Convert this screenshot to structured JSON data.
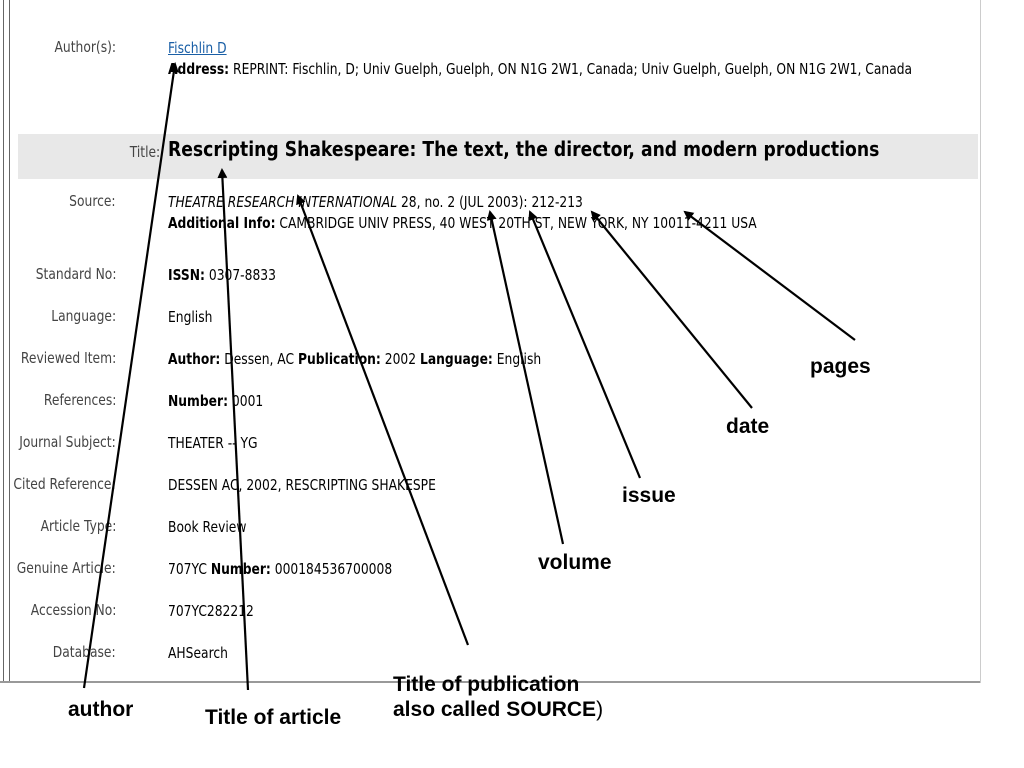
{
  "record": {
    "authors": {
      "label": "Author(s):",
      "name": "Fischlin D",
      "address_label": "Address:",
      "address_text": "REPRINT: Fischlin, D; Univ Guelph, Guelph, ON N1G 2W1, Canada; Univ Guelph, Guelph, ON N1G 2W1, Canada"
    },
    "title": {
      "label": "Title:",
      "value": "Rescripting Shakespeare: The text, the director, and modern productions"
    },
    "source": {
      "label": "Source:",
      "publication": "THEATRE RESEARCH INTERNATIONAL",
      "citation": " 28, no. 2 (JUL 2003): 212-213",
      "info_label": "Additional Info:",
      "info_text": "CAMBRIDGE UNIV PRESS, 40 WEST 20TH ST, NEW YORK, NY 10011-4211 USA"
    },
    "standard_no": {
      "label": "Standard No:",
      "issn_label": "ISSN:",
      "issn": "0307-8833"
    },
    "language": {
      "label": "Language:",
      "value": "English"
    },
    "reviewed_item": {
      "label": "Reviewed Item:",
      "author_label": "Author:",
      "author": "Dessen, AC",
      "pub_label": "Publication:",
      "pub": "2002",
      "lang_label": "Language:",
      "lang": "English"
    },
    "references": {
      "label": "References:",
      "number_label": "Number:",
      "number": "0001"
    },
    "journal_subject": {
      "label": "Journal Subject:",
      "value": "THEATER -- YG"
    },
    "cited_reference": {
      "label": "Cited Reference:",
      "value": "DESSEN AC, 2002, RESCRIPTING SHAKESPE"
    },
    "article_type": {
      "label": "Article Type:",
      "value": "Book Review"
    },
    "genuine_article": {
      "label": "Genuine Article:",
      "value": "707YC",
      "number_label": "Number:",
      "number": "000184536700008"
    },
    "accession_no": {
      "label": "Accession No:",
      "value": "707YC282212"
    },
    "database": {
      "label": "Database:",
      "value": "AHSearch"
    }
  },
  "annotations": {
    "pages": "pages",
    "date": "date",
    "issue": "issue",
    "volume": "volume",
    "author": "author",
    "article_title": "Title of article",
    "pub_title_line1": "Title of publication",
    "pub_title_line2": "also called SOURCE",
    "pub_title_paren": ")"
  }
}
